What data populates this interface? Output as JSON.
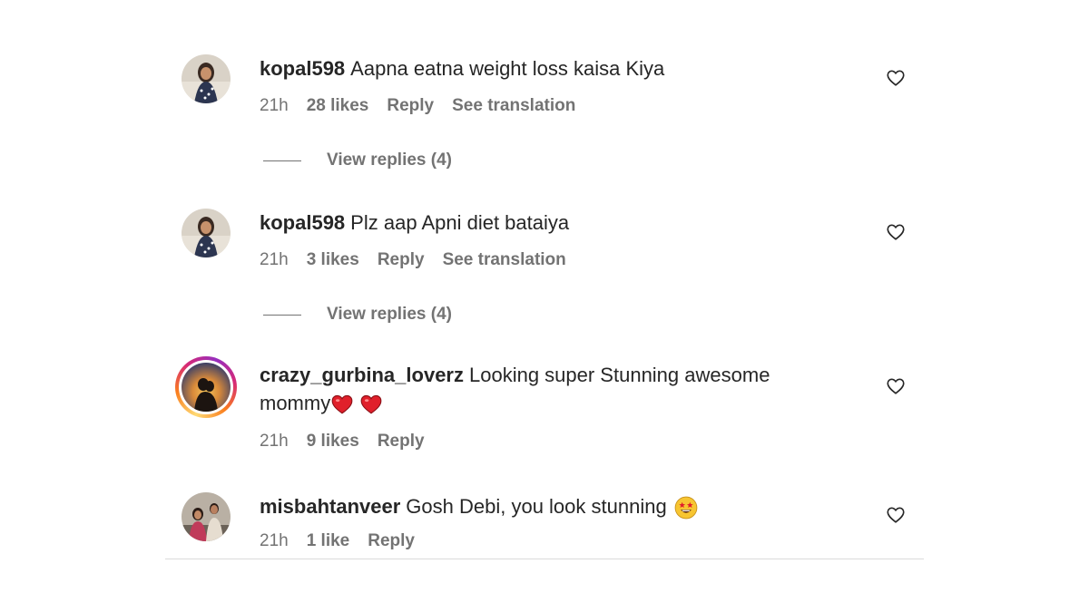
{
  "comments": [
    {
      "username": "kopal598",
      "text": "Aapna eatna weight loss kaisa Kiya",
      "time": "21h",
      "likes": "28 likes",
      "reply": "Reply",
      "translation": "See translation",
      "view_replies": "View replies (4)"
    },
    {
      "username": "kopal598",
      "text": "Plz aap Apni diet bataiya",
      "time": "21h",
      "likes": "3 likes",
      "reply": "Reply",
      "translation": "See translation",
      "view_replies": "View replies (4)"
    },
    {
      "username": "crazy_gurbina_loverz",
      "text": "Looking super Stunning awesome mommy",
      "time": "21h",
      "likes": "9 likes",
      "reply": "Reply"
    },
    {
      "username": "misbahtanveer",
      "text": "Gosh Debi, you look stunning",
      "time": "21h",
      "likes": "1 like",
      "reply": "Reply"
    }
  ],
  "icons": {
    "heart": "heart-outline-icon",
    "red_heart": "red-heart-emoji",
    "star_eyes": "star-struck-emoji"
  },
  "colors": {
    "text": "#262626",
    "secondary": "#737373",
    "divider": "#dbdbdb",
    "story_ring_start": "#feda75",
    "story_ring_end": "#962fbf",
    "heart_red": "#e0202b"
  }
}
